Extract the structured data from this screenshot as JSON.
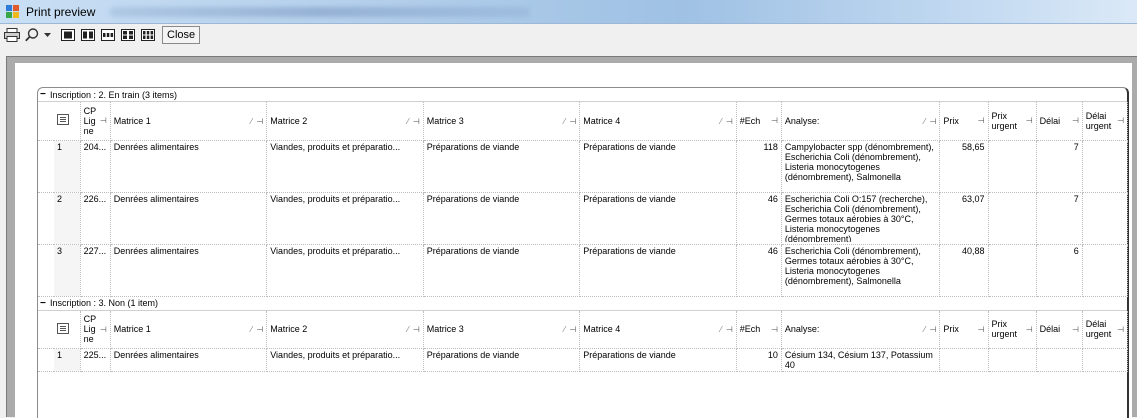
{
  "window": {
    "title": "Print preview"
  },
  "toolbar": {
    "close_label": "Close",
    "icons": [
      "print-icon",
      "zoom-icon",
      "dropdown-arrow-icon",
      "one-page-icon",
      "two-pages-icon",
      "three-pages-icon",
      "four-pages-icon",
      "six-pages-icon"
    ]
  },
  "columns": {
    "cp": "CP Lig ne",
    "matrice1": "Matrice 1",
    "matrice2": "Matrice 2",
    "matrice3": "Matrice 3",
    "matrice4": "Matrice 4",
    "nech": "#Ech",
    "analyse": "Analyse:",
    "prix": "Prix",
    "prix_urgent": "Prix urgent",
    "delai": "Délai",
    "delai_urgent": "Délai urgent"
  },
  "groups": [
    {
      "header": "Inscription : 2. En train (3 items)",
      "rows": [
        {
          "num": "1",
          "cp": "204...",
          "m1": "Denrées alimentaires",
          "m2": "Viandes, produits et préparatio...",
          "m3": "Préparations de viande",
          "m4": "Préparations de viande",
          "nech": "118",
          "analyse": "Campylobacter spp (dénombrement), Escherichia Coli (dénombrement), Listeria monocytogenes (dénombrement), Salmonella",
          "prix": "58,65",
          "prix_urgent": "",
          "delai": "7",
          "delai_urgent": ""
        },
        {
          "num": "2",
          "cp": "226...",
          "m1": "Denrées alimentaires",
          "m2": "Viandes, produits et préparatio...",
          "m3": "Préparations de viande",
          "m4": "Préparations de viande",
          "nech": "46",
          "analyse": "Escherichia Coli O:157 (recherche), Escherichia Coli (dénombrement), Germes totaux aérobies à 30°C, Listeria monocytogenes (dénombrement)",
          "prix": "63,07",
          "prix_urgent": "",
          "delai": "7",
          "delai_urgent": ""
        },
        {
          "num": "3",
          "cp": "227...",
          "m1": "Denrées alimentaires",
          "m2": "Viandes, produits et préparatio...",
          "m3": "Préparations de viande",
          "m4": "Préparations de viande",
          "nech": "46",
          "analyse": "Escherichia Coli (dénombrement), Germes totaux aérobies à 30°C, Listeria monocytogenes (dénombrement), Salmonella",
          "prix": "40,88",
          "prix_urgent": "",
          "delai": "6",
          "delai_urgent": ""
        }
      ]
    },
    {
      "header": "Inscription : 3. Non (1 item)",
      "rows": [
        {
          "num": "1",
          "cp": "225...",
          "m1": "Denrées alimentaires",
          "m2": "Viandes, produits et préparatio...",
          "m3": "Préparations de viande",
          "m4": "Préparations de viande",
          "nech": "10",
          "analyse": "Césium 134, Césium 137, Potassium 40",
          "prix": "",
          "prix_urgent": "",
          "delai": "",
          "delai_urgent": ""
        }
      ]
    }
  ]
}
